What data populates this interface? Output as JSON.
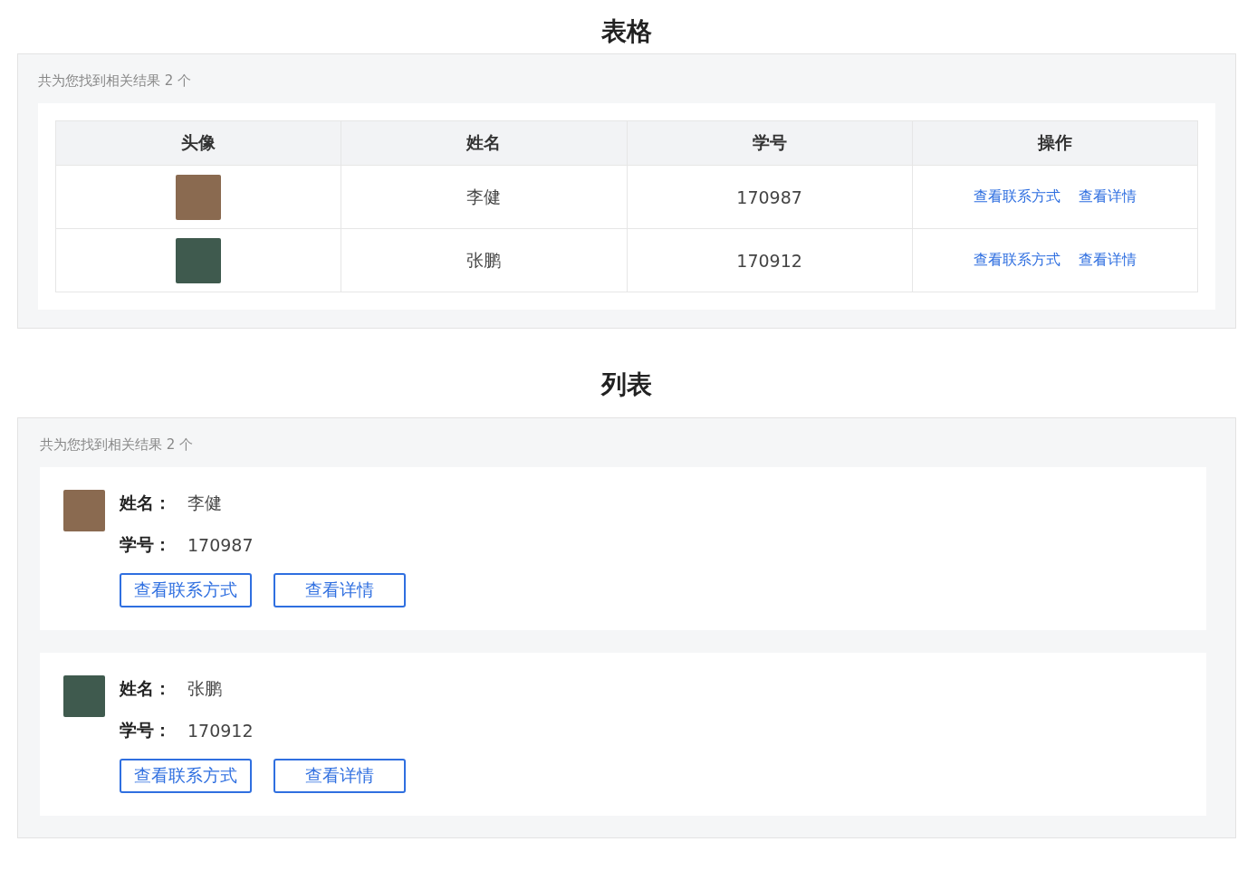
{
  "table_section": {
    "title": "表格",
    "summary": "共为您找到相关结果 2 个",
    "columns": [
      "头像",
      "姓名",
      "学号",
      "操作"
    ],
    "rows": [
      {
        "name": "李健",
        "id": "170987",
        "actions": [
          "查看联系方式",
          "查看详情"
        ]
      },
      {
        "name": "张鹏",
        "id": "170912",
        "actions": [
          "查看联系方式",
          "查看详情"
        ]
      }
    ]
  },
  "list_section": {
    "title": "列表",
    "summary": "共为您找到相关结果 2 个",
    "items": [
      {
        "name_label": "姓名：",
        "name": "李健",
        "id_label": "学号：",
        "id": "170987",
        "buttons": [
          "查看联系方式",
          "查看详情"
        ]
      },
      {
        "name_label": "姓名：",
        "name": "张鹏",
        "id_label": "学号：",
        "id": "170912",
        "buttons": [
          "查看联系方式",
          "查看详情"
        ]
      }
    ]
  }
}
